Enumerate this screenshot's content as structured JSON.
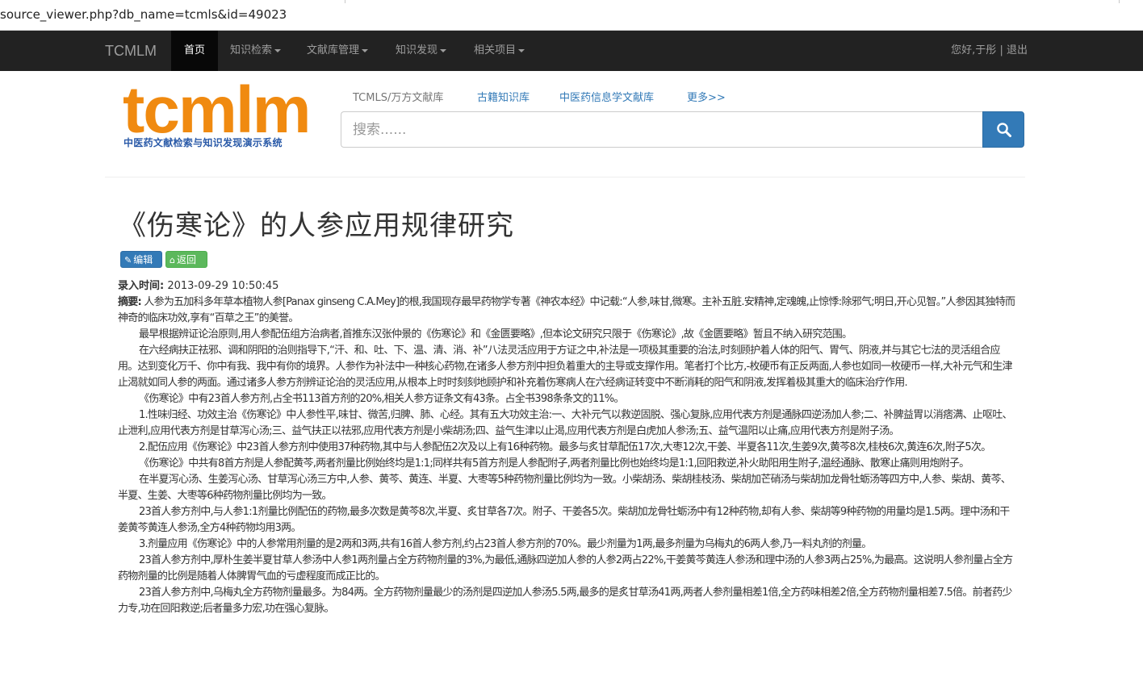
{
  "browser": {
    "url": "source_viewer.php?db_name=tcmls&id=49023"
  },
  "navbar": {
    "brand": "TCMLM",
    "items": [
      {
        "label": "首页",
        "dropdown": false,
        "active": true
      },
      {
        "label": "知识检索",
        "dropdown": true,
        "active": false
      },
      {
        "label": "文献库管理",
        "dropdown": true,
        "active": false
      },
      {
        "label": "知识发现",
        "dropdown": true,
        "active": false
      },
      {
        "label": "相关项目",
        "dropdown": true,
        "active": false
      }
    ],
    "greeting": "您好,于彤",
    "separator": "|",
    "logout": "退出"
  },
  "logo": {
    "wordmark": "tcmlm",
    "subtitle": "中医药文献检索与知识发现演示系统",
    "color": "#f08a10",
    "subtitle_color": "#2a5aa8"
  },
  "db_links": [
    {
      "label": "TCMLS/万方文献库",
      "style": "gray"
    },
    {
      "label": "古籍知识库",
      "style": "blue"
    },
    {
      "label": "中医药信息学文献库",
      "style": "blue"
    },
    {
      "label": "更多>>",
      "style": "blue"
    }
  ],
  "search": {
    "placeholder": "搜索......",
    "value": "",
    "button_icon": "search-icon"
  },
  "article": {
    "title": "《伤寒论》的人参应用规律研究",
    "buttons": {
      "edit": "编辑",
      "back": "返回"
    },
    "entry_time_label": "录入时间:",
    "entry_time": "2013-09-29 10:50:45",
    "abstract_label": "摘要:",
    "abstract_text": "人参为五加科多年草本植物人参[Panax ginseng C.A.Mey]的根,我国现存最早药物学专著《神农本经》中记载:“人参,味甘,微寒。主补五脏.安精神,定魂魄,止惊悸:除邪气;明日,开心见智。”人参因其独特而神奇的临床功效,享有“百草之王”的美誉。",
    "paragraphs": [
      "最早根据辨证论治原则,用人参配伍组方治病者,首推东汉张仲景的《伤寒论》和《金匮要略》,但本论文研究只限于《伤寒论》,故《金匮要略》暂且不纳入研究范围。",
      "在六经病扶正祛邪、调和阴阳的治则指导下,“汗、和、吐、下、温、清、消、补”八法灵活应用于方证之中,补法是一项极其重要的治法,时刻顾护着人体的阳气、胃气、阴液,并与其它七法的灵活组合应用。达到变化万千、你中有我、我中有你的境界。人参作为补法中一种核心药物,在诸多人参方剂中担负着重大的主导或支撑作用。笔者打个比方,-枚硬币有正反两面,人参也如同一枚硬币一样,大补元气和生津止渴就如同人参的两面。通过诸多人参方剂辨证论治的灵活应用,从根本上时时刻刻地顾护和补充着伤寒病人在六经病证转变中不断消耗的阳气和阴液,发挥着极其重大的临床治疗作用.",
      "《伤寒论》中有23首人参方剂,占全书113首方剂的20%,相关人参方证条文有43条。占全书398条条文的11%。",
      "1.性味归经、功效主治《伤寒论》中人参性平,味甘、微苦,归脾、肺、心经。其有五大功效主治:一、大补元气以救逆固脱、强心复脉,应用代表方剂是通脉四逆汤加人参;二、补脾益胃以消痞满、止呕吐、止泄利,应用代表方剂是甘草泻心汤;三、益气扶正以祛邪,应用代表方剂是小柴胡汤;四、益气生津以止渴,应用代表方剂是白虎加人参汤;五、益气温阳以止痛,应用代表方剂是附子汤。",
      "2.配伍应用《伤寒论》中23首人参方剂中使用37种药物,其中与人参配伍2次及以上有16种药物。最多与炙甘草配伍17次,大枣12次,干姜、半夏各11次,生姜9次,黄芩8次,桂枝6次,黄连6次,附子5次。",
      "《伤寒论》中共有8首方剂是人参配黄芩,两者剂量比例始终均是1:1;同样共有5首方剂是人参配附子,两者剂量比例也始终均是1:1,回阳救逆,补火助阳用生附子,温经通脉、散寒止痛则用炮附子。",
      "在半夏泻心汤、生姜泻心汤、甘草泻心汤三方中,人参、黄芩、黄连、半夏、大枣等5种药物剂量比例均为一致。小柴胡汤、柴胡桂枝汤、柴胡加芒硝汤与柴胡加龙骨牡蛎汤等四方中,人参、柴胡、黄芩、半夏、生姜、大枣等6种药物剂量比例均为一致。",
      "23首人参方剂中,与人参1:1剂量比例配伍的药物,最多次数是黄芩8次,半夏、炙甘草各7次。附子、干姜各5次。柴胡加龙骨牡蛎汤中有12种药物,却有人参、柴胡等9种药物的用量均是1.5两。理中汤和干姜黄芩黄连人参汤,全方4种药物均用3两。",
      "3.剂量应用《伤寒论》中的人参常用剂量的是2两和3两,共有16首人参方剂,约占23首人参方剂的70%。最少剂量为1两,最多剂量为乌梅丸的6两人参,乃一料丸剂的剂量。",
      "23首人参方剂中,厚朴生姜半夏甘草人参汤中人参1两剂量占全方药物剂量的3%,为最低,通脉四逆加人参的人参2两占22%,干姜黄芩黄连人参汤和理中汤的人参3两占25%,为最高。这说明人参剂量占全方药物剂量的比例是随着人体脾胃气血的亏虚程度而成正比的。",
      "23首人参方剂中,乌梅丸全方药物剂量最多。为84两。全方药物剂量最少的汤剂是四逆加人参汤5.5两,最多的是炙甘草汤41两,两者人参剂量相差1倍,全方药味相差2倍,全方药物剂量相差7.5倍。前者药少力专,功在回阳救逆;后者量多力宏,功在强心复脉。"
    ]
  }
}
